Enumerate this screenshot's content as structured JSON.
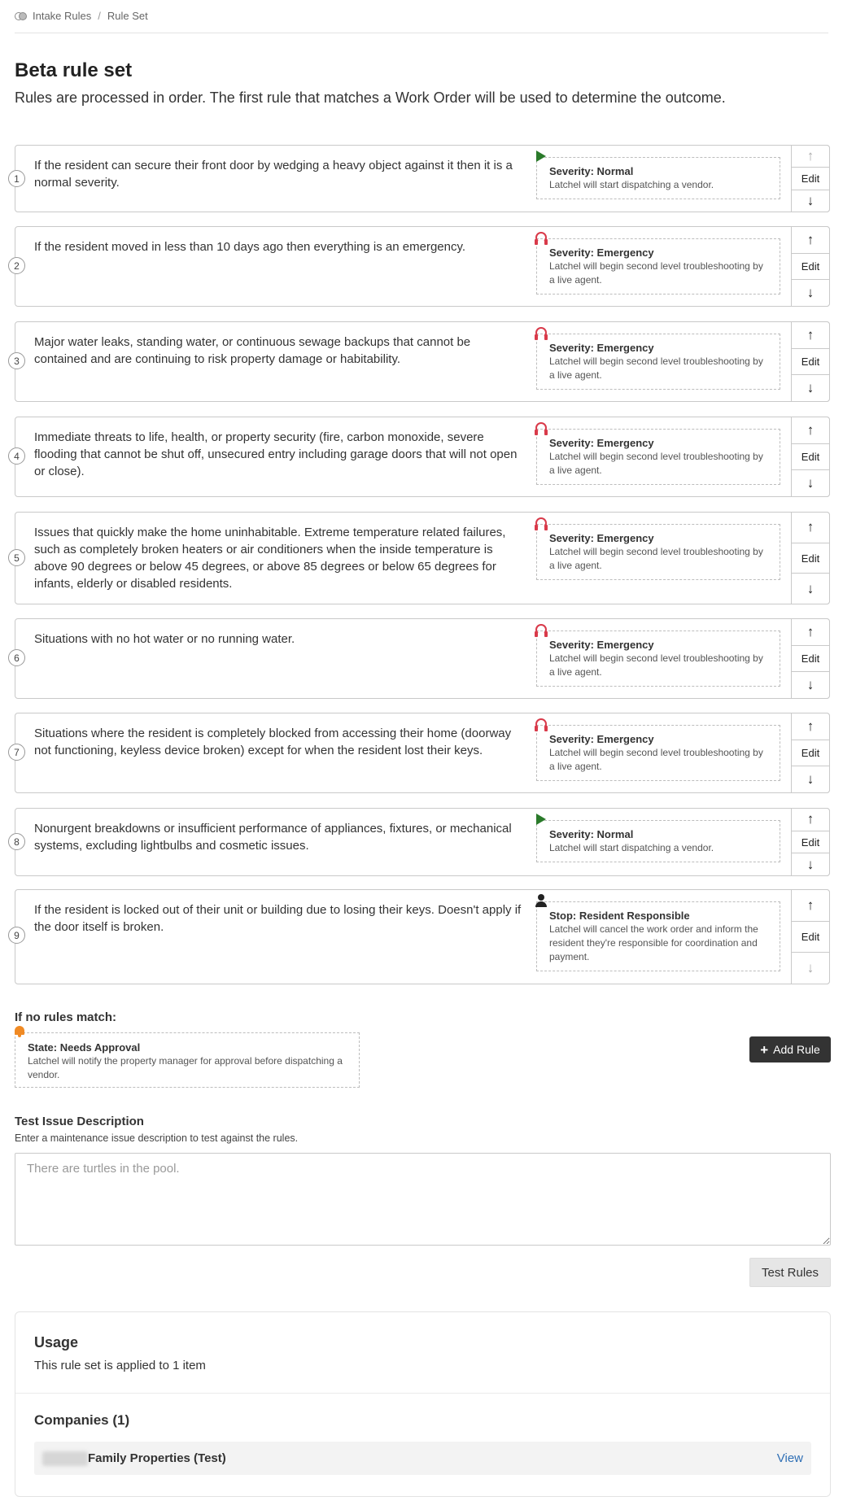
{
  "breadcrumb": {
    "root": "Intake Rules",
    "separator": "/",
    "current": "Rule Set"
  },
  "page": {
    "title": "Beta rule set",
    "subtitle": "Rules are processed in order. The first rule that matches a Work Order will be used to determine the outcome."
  },
  "rules": [
    {
      "number": "1",
      "text": "If the resident can secure their front door by wedging a heavy object against it then it is a normal severity.",
      "icon": "play-icon",
      "outcome_title": "Severity: Normal",
      "outcome_desc": "Latchel will start dispatching a vendor."
    },
    {
      "number": "2",
      "text": "If the resident moved in less than 10 days ago then everything is an emergency.",
      "icon": "headset-icon",
      "outcome_title": "Severity: Emergency",
      "outcome_desc": "Latchel will begin second level troubleshooting by a live agent."
    },
    {
      "number": "3",
      "text": "Major water leaks, standing water, or continuous sewage backups that cannot be contained and are continuing to risk property damage or habitability.",
      "icon": "headset-icon",
      "outcome_title": "Severity: Emergency",
      "outcome_desc": "Latchel will begin second level troubleshooting by a live agent."
    },
    {
      "number": "4",
      "text": "Immediate threats to life, health, or property security (fire, carbon monoxide, severe flooding that cannot be shut off, unsecured entry including garage doors that will not open or close).",
      "icon": "headset-icon",
      "outcome_title": "Severity: Emergency",
      "outcome_desc": "Latchel will begin second level troubleshooting by a live agent."
    },
    {
      "number": "5",
      "text": "Issues that quickly make the home uninhabitable. Extreme temperature related failures, such as completely broken heaters or air conditioners when the inside temperature is above 90 degrees or below 45 degrees, or above 85 degrees or below 65 degrees for infants, elderly or disabled residents.",
      "icon": "headset-icon",
      "outcome_title": "Severity: Emergency",
      "outcome_desc": "Latchel will begin second level troubleshooting by a live agent."
    },
    {
      "number": "6",
      "text": "Situations with no hot water or no running water.",
      "icon": "headset-icon",
      "outcome_title": "Severity: Emergency",
      "outcome_desc": "Latchel will begin second level troubleshooting by a live agent."
    },
    {
      "number": "7",
      "text": "Situations where the resident is completely blocked from accessing their home (doorway not functioning, keyless device broken) except for when the resident lost their keys.",
      "icon": "headset-icon",
      "outcome_title": "Severity: Emergency",
      "outcome_desc": "Latchel will begin second level troubleshooting by a live agent."
    },
    {
      "number": "8",
      "text": "Nonurgent breakdowns or insufficient performance of appliances, fixtures, or mechanical systems, excluding lightbulbs and cosmetic issues.",
      "icon": "play-icon",
      "outcome_title": "Severity: Normal",
      "outcome_desc": "Latchel will start dispatching a vendor."
    },
    {
      "number": "9",
      "text": "If the resident is locked out of their unit or building due to losing their keys. Doesn't apply if the door itself is broken.",
      "icon": "person-icon",
      "outcome_title": "Stop: Resident Responsible",
      "outcome_desc": "Latchel will cancel the work order and inform the resident they're responsible for coordination and payment."
    }
  ],
  "controls": {
    "up": "↑",
    "edit": "Edit",
    "down": "↓"
  },
  "no_match": {
    "label": "If no rules match:",
    "icon": "bell-icon",
    "title": "State: Needs Approval",
    "desc": "Latchel will notify the property manager for approval before dispatching a vendor."
  },
  "add_rule": {
    "plus": "+",
    "label": "Add Rule"
  },
  "test": {
    "label": "Test Issue Description",
    "help": "Enter a maintenance issue description to test against the rules.",
    "placeholder": "There are turtles in the pool.",
    "button": "Test Rules"
  },
  "usage": {
    "title": "Usage",
    "subtitle": "This rule set is applied to 1 item",
    "companies_title": "Companies (1)",
    "company_name": "Family Properties (Test)",
    "view_label": "View"
  },
  "colors": {
    "normal_icon": "#2a7a2a",
    "emergency_icon": "#d93a4a",
    "approval_icon": "#f08a24",
    "primary_button": "#333333",
    "link": "#2f6fb5"
  }
}
